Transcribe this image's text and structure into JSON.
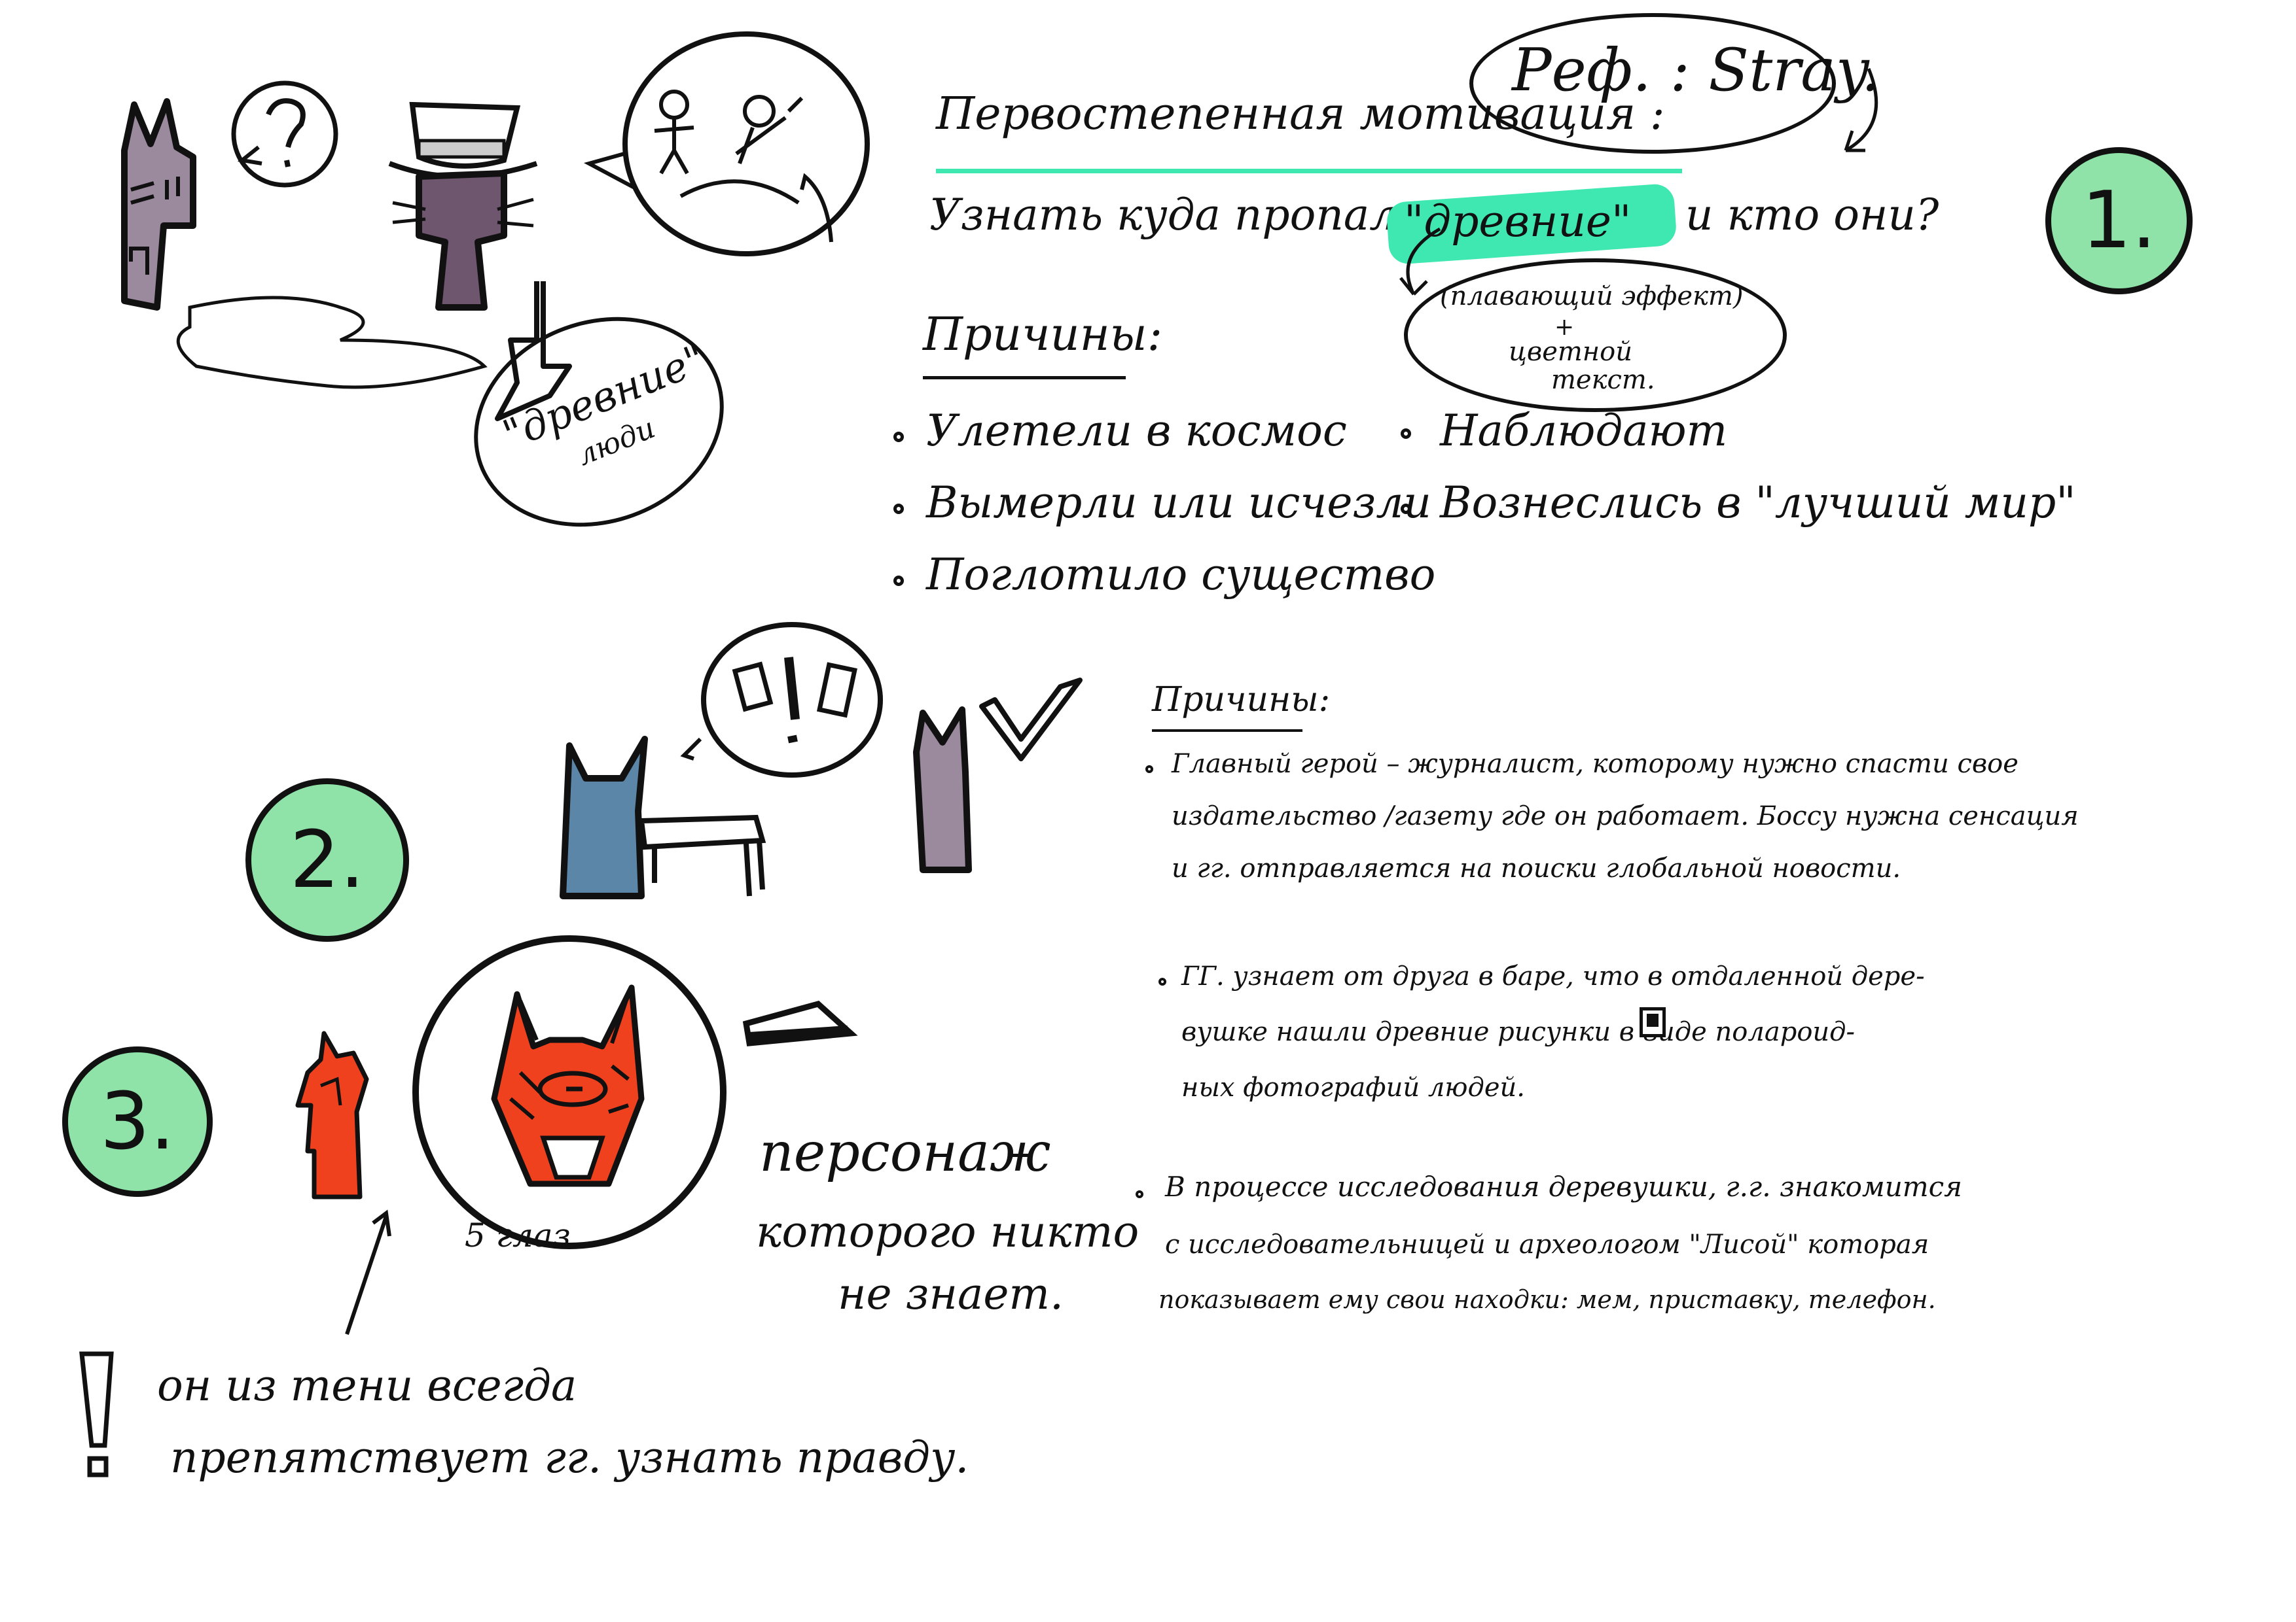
{
  "reference": "Реф. : Stray.",
  "section1": {
    "number": "1.",
    "heading": "Первостепенная мотивация :",
    "goal_prefix": "Узнать куда пропали",
    "goal_highlight": "\"древние\"",
    "goal_suffix": "и кто они?",
    "effect_note": [
      "(плавающий эффект)",
      "+",
      "цветной",
      "текст."
    ],
    "reasons_title": "Причины:",
    "reasons_left": [
      "Улетели в космос",
      "Вымерли или исчезли",
      "Поглотило существо"
    ],
    "reasons_right": [
      "Наблюдают",
      "Вознеслись в \"лучший мир\""
    ],
    "ancients_bubble": [
      "\"древние\"",
      "люди"
    ]
  },
  "section2": {
    "number": "2.",
    "reasons_title": "Причины:",
    "items": [
      [
        "Главный герой – журналист, которому нужно спасти свое",
        "издательство /газету где он работает. Боссу нужна сенсация",
        "и гг. отправляется на поиски глобальной новости."
      ],
      [
        "ГГ. узнает от друга в баре, что в отдаленной дере-",
        "вушке нашли древние рисунки в виде полароид-",
        "ных фотографий людей."
      ],
      [
        "В процессе исследования деревушки, г.г. знакомится",
        "с исследовательницей и археологом \"Лисой\" которая",
        "показывает ему свои находки: мем, приставку, телефон."
      ]
    ]
  },
  "section3": {
    "number": "3.",
    "eyes_note": "5 глаз.",
    "character_note": [
      "персонаж",
      "которого никто",
      "не знает."
    ],
    "warning": [
      "он из тени всегда",
      "препятствует гг. узнать правду."
    ]
  },
  "colors": {
    "accent_green": "#8fe3a8",
    "highlight_green": "#3ee8b0",
    "fox_red": "#f0411f",
    "cat_purple": "#9b8a9e",
    "cat_blue": "#5b86a8"
  }
}
